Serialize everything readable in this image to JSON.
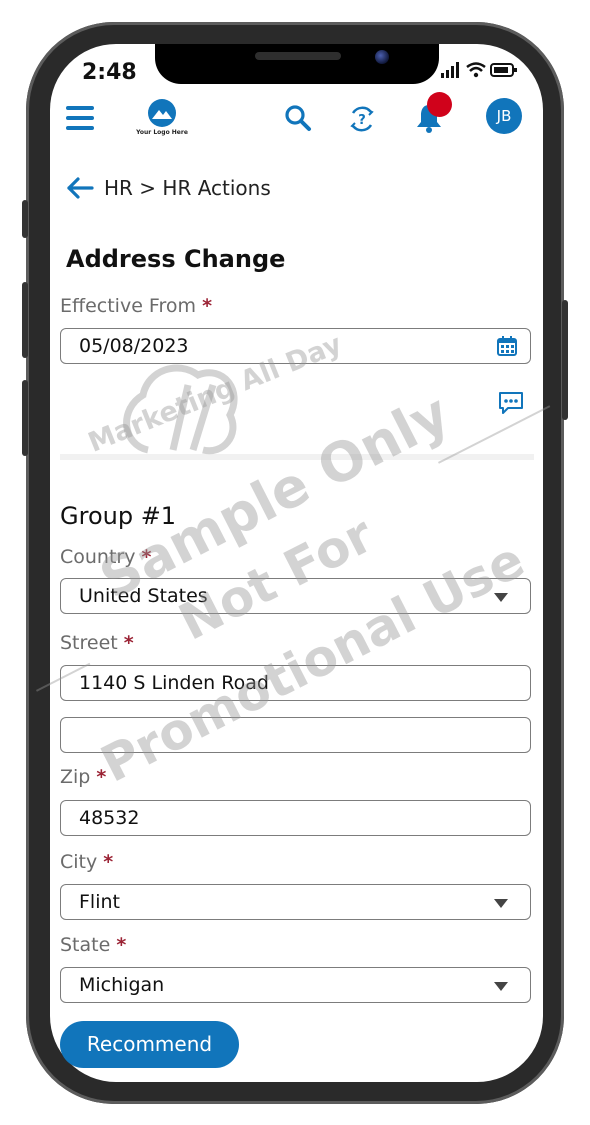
{
  "status_bar": {
    "time": "2:48"
  },
  "header": {
    "logo_text": "Your Logo Here",
    "avatar_initials": "JB"
  },
  "breadcrumb": {
    "text": "HR > HR Actions"
  },
  "page": {
    "title": "Address Change"
  },
  "effective_from": {
    "label": "Effective From",
    "required_mark": "*",
    "value": "05/08/2023"
  },
  "group": {
    "title": "Group #1"
  },
  "country": {
    "label": "Country",
    "required_mark": "*",
    "value": "United States"
  },
  "street": {
    "label": "Street",
    "required_mark": "*",
    "line1": "1140 S Linden Road",
    "line2": ""
  },
  "zip": {
    "label": "Zip",
    "required_mark": "*",
    "value": "48532"
  },
  "city": {
    "label": "City",
    "required_mark": "*",
    "value": "Flint"
  },
  "state": {
    "label": "State",
    "required_mark": "*",
    "value": "Michigan"
  },
  "actions": {
    "recommend_label": "Recommend"
  },
  "watermark": {
    "brand": "Marketing All Day",
    "line1": "Sample Only",
    "line2": "Not For",
    "line3": "Promotional Use"
  },
  "colors": {
    "primary": "#1175bb",
    "required": "#9b2335",
    "notification": "#d0021b"
  }
}
